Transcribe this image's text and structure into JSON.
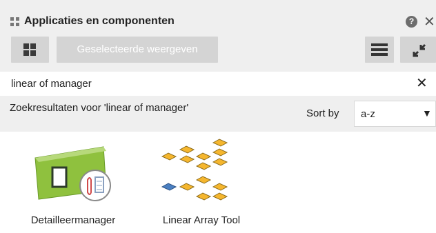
{
  "panel": {
    "title": "Applicaties en componenten",
    "icons": {
      "grip": "panel-grip-icon",
      "help": "help-icon",
      "close": "close-icon"
    },
    "help_glyph": "?",
    "close_glyph": "✕"
  },
  "toolbar": {
    "grid_icon": "grid-view-icon",
    "selected_label": "Geselecteerde weergeven",
    "list_icon": "list-view-icon",
    "collapse_icon": "collapse-icon"
  },
  "search": {
    "value": "linear of manager",
    "clear_glyph": "✕"
  },
  "results": {
    "label": "Zoekresultaten voor 'linear of manager'",
    "sort_label": "Sort by",
    "sort_value": "a-z",
    "sort_caret": "▼"
  },
  "apps": [
    {
      "label": "Detailleermanager",
      "icon": "detail-manager-icon"
    },
    {
      "label": "Linear Array Tool",
      "icon": "linear-array-tool-icon"
    }
  ],
  "colors": {
    "panel_bg": "#efefef",
    "button_bg": "#d4d4d4",
    "content_bg": "#ffffff",
    "accent_green": "#8fc13e",
    "accent_orange": "#f5b62e",
    "accent_blue": "#4a7fc1"
  }
}
